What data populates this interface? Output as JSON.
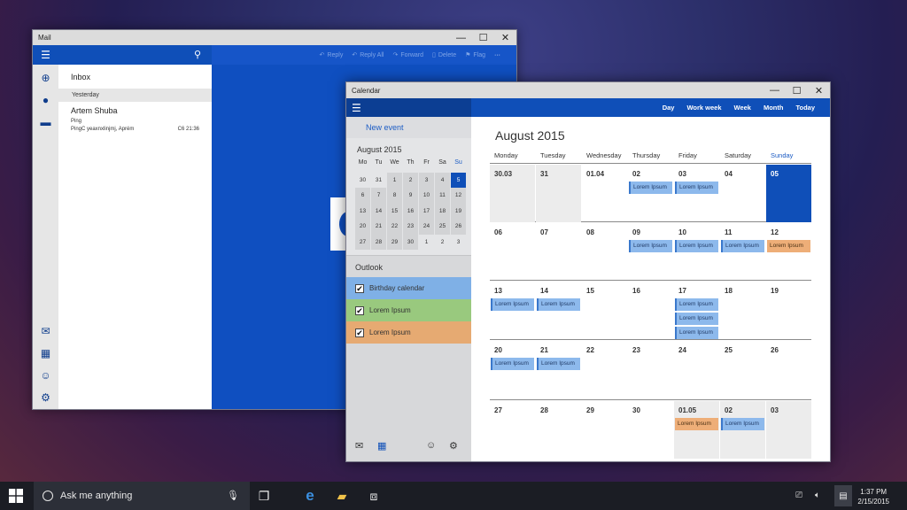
{
  "mail": {
    "title": "Mail",
    "inbox_label": "Inbox",
    "group_label": "Yesterday",
    "message": {
      "from": "Artem Shuba",
      "subject": "Ping",
      "preview": "PingC yeaxnxlinjmj, Aprém",
      "time": "C6 21:36"
    },
    "toolbar": {
      "reply": "Reply",
      "reply_all": "Reply All",
      "forward": "Forward",
      "delete": "Delete",
      "flag": "Flag",
      "more": "···"
    }
  },
  "calendar": {
    "title": "Calendar",
    "new_event": "New event",
    "views": [
      "Day",
      "Work week",
      "Week",
      "Month",
      "Today"
    ],
    "month_title": "August 2015",
    "weekdays": [
      "Monday",
      "Tuesday",
      "Wednesday",
      "Thursday",
      "Friday",
      "Saturday",
      "Sunday"
    ],
    "mini": {
      "title": "August 2015",
      "day_headers": [
        "Mo",
        "Tu",
        "We",
        "Th",
        "Fr",
        "Sa",
        "Su"
      ],
      "weeks": [
        [
          "30",
          "31",
          "1",
          "2",
          "3",
          "4",
          "5"
        ],
        [
          "6",
          "7",
          "8",
          "9",
          "10",
          "11",
          "12"
        ],
        [
          "13",
          "14",
          "15",
          "16",
          "17",
          "18",
          "19"
        ],
        [
          "20",
          "21",
          "22",
          "23",
          "24",
          "25",
          "26"
        ],
        [
          "27",
          "28",
          "29",
          "30",
          "1",
          "2",
          "3"
        ]
      ]
    },
    "outlook_label": "Outlook",
    "calendars": [
      {
        "name": "Birthday calendar",
        "color": "#7fb0e6"
      },
      {
        "name": "Lorem Ipsum",
        "color": "#99c97e"
      },
      {
        "name": "Lorem Ipsum",
        "color": "#e6aa72"
      }
    ],
    "grid": [
      [
        "30.03",
        "31",
        "01.04",
        "02",
        "03",
        "04",
        "05"
      ],
      [
        "06",
        "07",
        "08",
        "09",
        "10",
        "11",
        "12"
      ],
      [
        "13",
        "14",
        "15",
        "16",
        "17",
        "18",
        "19"
      ],
      [
        "20",
        "21",
        "22",
        "23",
        "24",
        "25",
        "26"
      ],
      [
        "27",
        "28",
        "29",
        "30",
        "01.05",
        "02",
        "03"
      ]
    ],
    "event_label": "Lorem Ipsum"
  },
  "taskbar": {
    "search_text": "Ask me anything",
    "time": "1:37 PM",
    "date": "2/15/2015"
  },
  "colors": {
    "accent": "#0f4fb8",
    "event_blue": "#8db9ec",
    "event_orange": "#eeae78"
  }
}
